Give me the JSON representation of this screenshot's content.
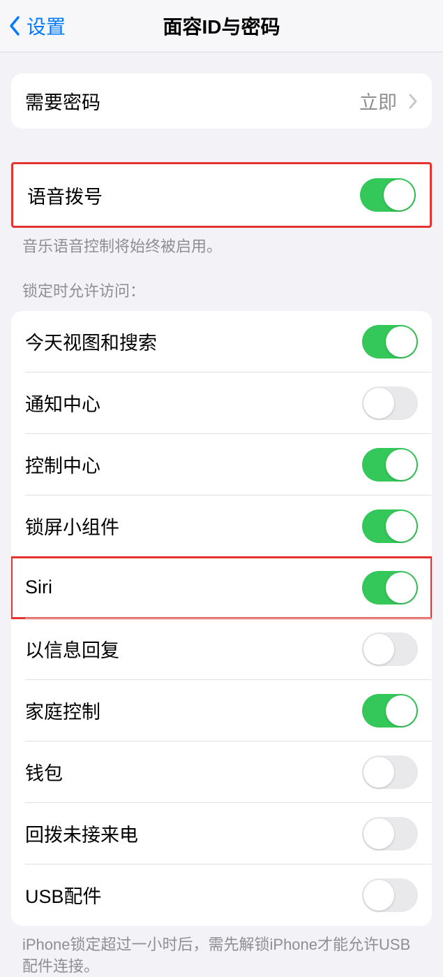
{
  "nav": {
    "back_label": "设置",
    "title": "面容ID与密码"
  },
  "require_passcode": {
    "label": "需要密码",
    "value": "立即"
  },
  "voice_dial": {
    "label": "语音拨号",
    "on": true,
    "footer": "音乐语音控制将始终被启用。"
  },
  "locked_access": {
    "header": "锁定时允许访问：",
    "items": [
      {
        "label": "今天视图和搜索",
        "on": true
      },
      {
        "label": "通知中心",
        "on": false
      },
      {
        "label": "控制中心",
        "on": true
      },
      {
        "label": "锁屏小组件",
        "on": true
      },
      {
        "label": "Siri",
        "on": true,
        "highlighted": true
      },
      {
        "label": "以信息回复",
        "on": false
      },
      {
        "label": "家庭控制",
        "on": true
      },
      {
        "label": "钱包",
        "on": false
      },
      {
        "label": "回拨未接来电",
        "on": false
      },
      {
        "label": "USB配件",
        "on": false
      }
    ],
    "footer": "iPhone锁定超过一小时后，需先解锁iPhone才能允许USB配件连接。"
  }
}
